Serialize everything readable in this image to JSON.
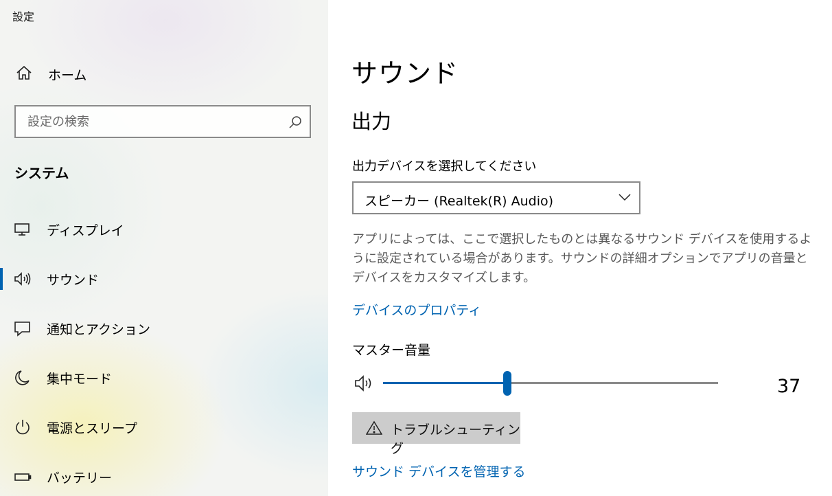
{
  "app": {
    "title": "設定"
  },
  "sidebar": {
    "home_label": "ホーム",
    "search": {
      "placeholder": "設定の検索",
      "value": ""
    },
    "section_label": "システム",
    "items": [
      {
        "label": "ディスプレイ",
        "icon": "monitor-icon",
        "selected": false
      },
      {
        "label": "サウンド",
        "icon": "speaker-icon",
        "selected": true
      },
      {
        "label": "通知とアクション",
        "icon": "notification-icon",
        "selected": false
      },
      {
        "label": "集中モード",
        "icon": "moon-icon",
        "selected": false
      },
      {
        "label": "電源とスリープ",
        "icon": "power-icon",
        "selected": false
      },
      {
        "label": "バッテリー",
        "icon": "battery-icon",
        "selected": false
      }
    ]
  },
  "main": {
    "title": "サウンド",
    "output": {
      "heading": "出力",
      "device_label": "出力デバイスを選択してください",
      "device_value": "スピーカー (Realtek(R) Audio)",
      "help_text": "アプリによっては、ここで選択したものとは異なるサウンド デバイスを使用するように設定されている場合があります。サウンドの詳細オプションでアプリの音量とデバイスをカスタマイズします。",
      "properties_link": "デバイスのプロパティ",
      "volume_label": "マスター音量",
      "volume_value": "37",
      "volume_fraction": 0.37,
      "troubleshoot_label": "トラブルシューティング",
      "manage_link": "サウンド デバイスを管理する"
    }
  },
  "colors": {
    "accent": "#0063b1",
    "text": "#000000",
    "help_text": "#5a5a5a",
    "button_bg": "#cccccc",
    "border": "#8a8a8a"
  }
}
